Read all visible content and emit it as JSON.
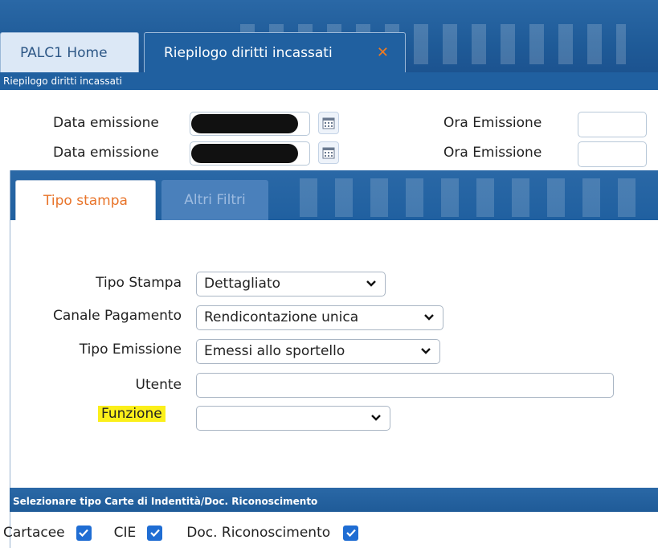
{
  "window_tabs": {
    "home_label": "PALC1 Home",
    "active_label": "Riepilogo diritti incassati",
    "close_glyph": "✕"
  },
  "subtitle": "Riepilogo diritti incassati",
  "header": {
    "row1": {
      "date_label": "Data emissione",
      "time_label": "Ora Emissione",
      "date_value_redacted": true
    },
    "row2": {
      "date_label": "Data emissione",
      "time_label": "Ora Emissione",
      "date_value_redacted": true
    },
    "calendar_icon": "calendar-icon"
  },
  "panel_tabs": [
    {
      "label": "Tipo stampa",
      "active": true
    },
    {
      "label": "Altri Filtri",
      "active": false
    }
  ],
  "form": {
    "tipo_stampa": {
      "label": "Tipo Stampa",
      "value": "Dettagliato"
    },
    "canale_pagamento": {
      "label": "Canale Pagamento",
      "value": "Rendicontazione unica"
    },
    "tipo_emissione": {
      "label": "Tipo Emissione",
      "value": "Emessi allo sportello"
    },
    "utente": {
      "label": "Utente",
      "value": ""
    },
    "funzione": {
      "label": "Funzione",
      "value": "",
      "highlight_color": "#fbef1a"
    }
  },
  "section": {
    "title": "Selezionare tipo Carte di Indentità/Doc. Riconoscimento",
    "checkboxes": [
      {
        "label": "Cartacee",
        "checked": true
      },
      {
        "label": "CIE",
        "checked": true
      },
      {
        "label": "Doc. Riconoscimento",
        "checked": true
      }
    ]
  },
  "colors": {
    "brand_blue": "#2060a0",
    "active_tab_text": "#e8742a",
    "checkbox": "#1f6dd3",
    "close_x": "#f07b20"
  }
}
